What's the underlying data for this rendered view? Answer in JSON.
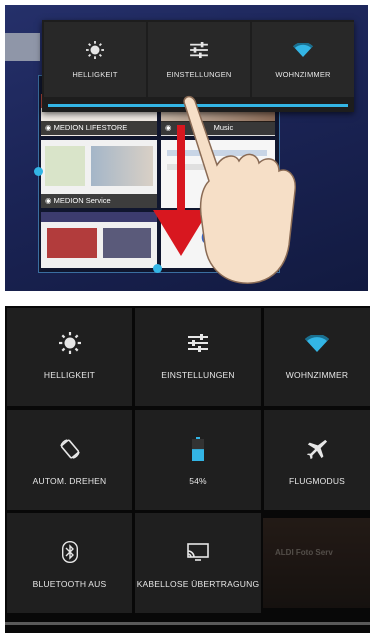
{
  "top_panel": {
    "quick_settings": [
      {
        "label": "HELLIGKEIT",
        "icon": "brightness-icon"
      },
      {
        "label": "EINSTELLUNGEN",
        "icon": "settings-sliders-icon"
      },
      {
        "label": "WOHNZIMMER",
        "icon": "wifi-icon"
      }
    ],
    "recent_apps": [
      {
        "label": "MEDION LIFESTORE"
      },
      {
        "label": "Music"
      },
      {
        "label": "MEDION Service"
      }
    ]
  },
  "bottom_panel": {
    "tiles": [
      {
        "label": "HELLIGKEIT",
        "icon": "brightness-icon"
      },
      {
        "label": "EINSTELLUNGEN",
        "icon": "settings-sliders-icon"
      },
      {
        "label": "WOHNZIMMER",
        "icon": "wifi-icon"
      },
      {
        "label": "AUTOM. DREHEN",
        "icon": "auto-rotate-icon"
      },
      {
        "label": "54%",
        "icon": "battery-icon",
        "level": 0.54
      },
      {
        "label": "FLUGMODUS",
        "icon": "airplane-icon"
      },
      {
        "label": "BLUETOOTH AUS",
        "icon": "bluetooth-icon"
      },
      {
        "label": "KABELLOSE ÜBERTRAGUNG",
        "icon": "wireless-display-icon"
      }
    ],
    "background_peek_text": "ALDI Foto Serv"
  },
  "colors": {
    "accent": "#33b5e5",
    "arrow": "#d8171f",
    "tile_bg": "#1f1f1f",
    "panel_bg": "#080808"
  }
}
